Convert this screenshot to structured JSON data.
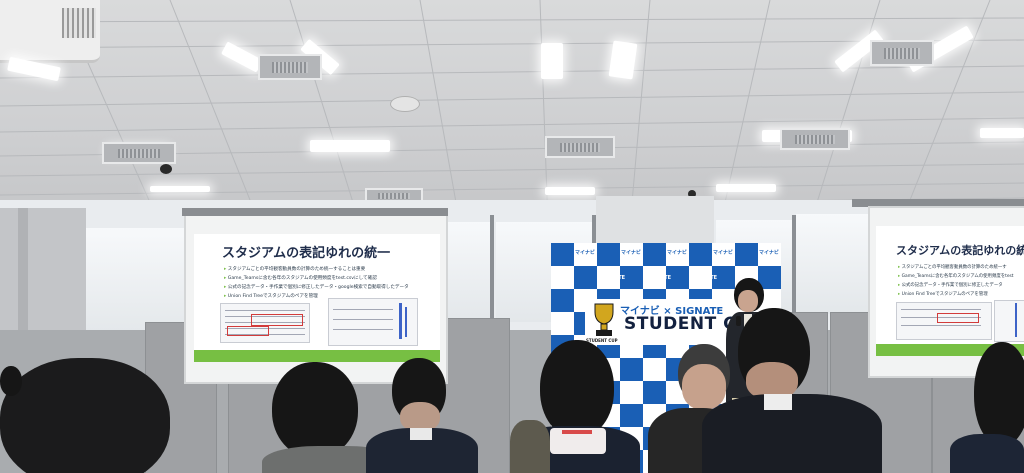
{
  "scene": {
    "description_type": "photo",
    "colors": {
      "slide_green": "#77bf43",
      "backdrop_blue": "#1a5fb5",
      "ceiling": "#d4d5d7",
      "title_navy": "#1f2d4b"
    }
  },
  "left_slide": {
    "title": "スタジアムの表記ゆれの統一",
    "bullets": [
      "スタジアムごとの平均観客動員数の計算のため統一することは重要",
      "Game_Teamsに含む各年のスタジアムの使用頻度をtest.csvにして確認",
      "公式の記念データ・手作業で個別に修正したデータ・google検索で自動取得したデータ",
      "Union Find Treeでスタジアムのペアを管理"
    ]
  },
  "right_slide": {
    "title": "スタジアムの表記ゆれの統一",
    "bullets": [
      "スタジアムごとの平均観客動員数の計算のため統一す",
      "Game_Teamsに含む各年のスタジアムの使用頻度をtest",
      "公式の記念データ・手作業で個別に修正したデータ",
      "Union Find Treeでスタジアムのペアを管理"
    ]
  },
  "backdrop": {
    "sponsor_small": "マイナビ",
    "partner_small": "SIGNATE",
    "brand_line": "マイナビ × SIGNATE",
    "event_title": "STUDENT CUP 20",
    "trophy_caption": "STUDENT CUP"
  }
}
